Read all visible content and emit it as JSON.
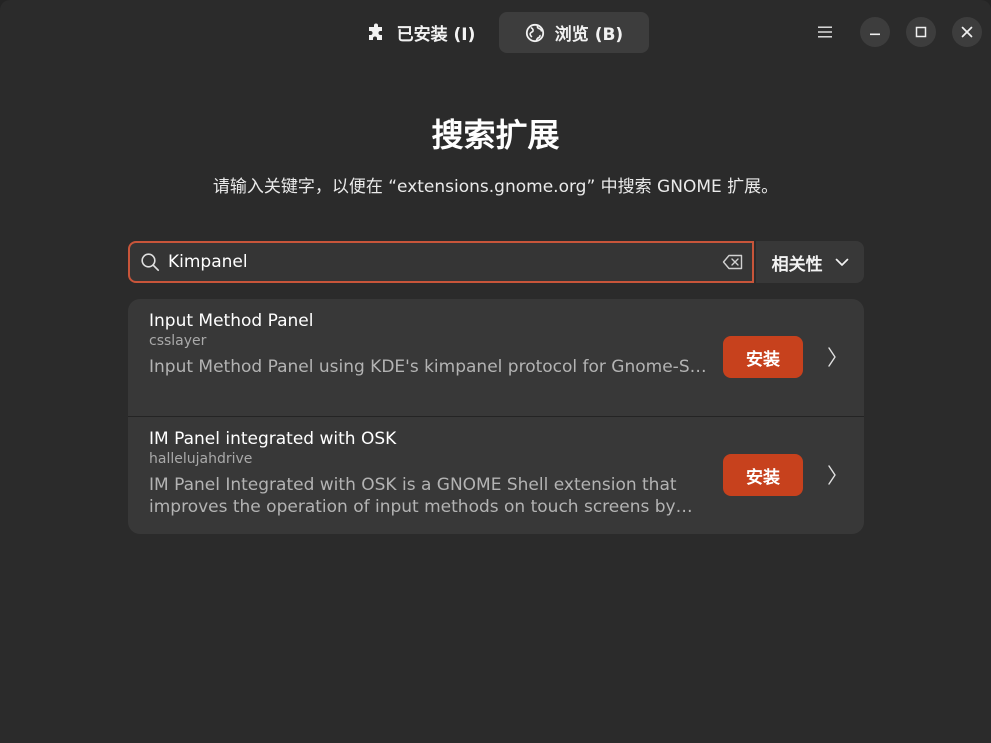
{
  "header": {
    "tabs": [
      {
        "label": "已安装 (I)",
        "icon": "puzzle-icon"
      },
      {
        "label": "浏览 (B)",
        "icon": "globe-icon",
        "active": true
      }
    ],
    "menu_icon": "hamburger-menu-icon",
    "window_controls": [
      "minimize-icon",
      "maximize-icon",
      "close-icon"
    ]
  },
  "main": {
    "title": "搜索扩展",
    "subtitle": "请输入关键字，以便在 “extensions.gnome.org” 中搜索 GNOME 扩展。",
    "search": {
      "value": "Kimpanel",
      "icon": "search-icon",
      "clear_icon": "backspace-clear-icon"
    },
    "sort": {
      "selected": "相关性",
      "icon": "chevron-down-icon"
    },
    "results": [
      {
        "name": "Input Method Panel",
        "author": "csslayer",
        "description": "Input Method Panel using KDE's kimpanel protocol for Gnome-Shell",
        "install_label": "安装"
      },
      {
        "name": "IM Panel integrated with OSK",
        "author": "hallelujahdrive",
        "description": "IM Panel Integrated with OSK is a GNOME Shell extension that improves the operation of input methods on touch screens by ad…",
        "install_label": "安装"
      }
    ]
  },
  "colors": {
    "window_bg": "#2b2b2b",
    "card_bg": "#383838",
    "accent": "#c7411d",
    "focus_ring": "#c8553a"
  }
}
